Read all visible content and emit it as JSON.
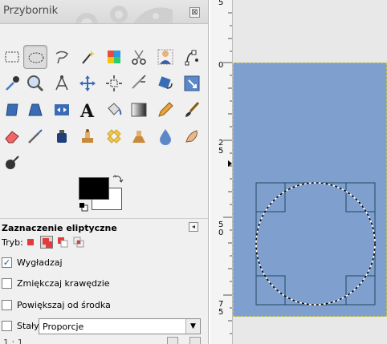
{
  "toolbox": {
    "title": "Przybornik",
    "close_symbol": "⊠",
    "tools": [
      {
        "name": "rect-select-icon"
      },
      {
        "name": "ellipse-select-icon",
        "active": true
      },
      {
        "name": "free-select-icon"
      },
      {
        "name": "fuzzy-select-icon"
      },
      {
        "name": "select-by-color-icon"
      },
      {
        "name": "scissors-icon"
      },
      {
        "name": "foreground-select-icon"
      },
      {
        "name": "paths-icon"
      },
      {
        "name": "color-picker-icon"
      },
      {
        "name": "zoom-icon"
      },
      {
        "name": "measure-icon"
      },
      {
        "name": "move-icon"
      },
      {
        "name": "align-icon"
      },
      {
        "name": "crop-icon"
      },
      {
        "name": "rotate-icon"
      },
      {
        "name": "scale-icon"
      },
      {
        "name": "shear-icon"
      },
      {
        "name": "perspective-icon"
      },
      {
        "name": "flip-icon"
      },
      {
        "name": "text-icon"
      },
      {
        "name": "bucket-fill-icon"
      },
      {
        "name": "blend-icon"
      },
      {
        "name": "pencil-icon"
      },
      {
        "name": "paintbrush-icon"
      },
      {
        "name": "eraser-icon"
      },
      {
        "name": "airbrush-icon"
      },
      {
        "name": "ink-icon"
      },
      {
        "name": "clone-icon"
      },
      {
        "name": "heal-icon"
      },
      {
        "name": "perspective-clone-icon"
      },
      {
        "name": "blur-icon"
      },
      {
        "name": "smudge-icon"
      },
      {
        "name": "dodge-burn-icon"
      }
    ],
    "colors": {
      "foreground": "#000000",
      "background": "#ffffff"
    }
  },
  "tool_options": {
    "title": "Zaznaczenie eliptyczne",
    "mode_label": "Tryb:",
    "antialias": {
      "label": "Wygładzaj",
      "checked": true
    },
    "feather": {
      "label": "Zmiękczaj krawędzie",
      "checked": false
    },
    "expand": {
      "label": "Powiększaj od środka",
      "checked": false
    },
    "fixed": {
      "label": "Stały:",
      "checked": false,
      "value": "Proporcje"
    },
    "cut_text": "1 : 1 ...",
    "menu_symbol": "◂",
    "dropdown_symbol": "▼"
  },
  "canvas": {
    "ruler_labels": [
      "5",
      "0",
      "2",
      "5",
      "5",
      "0",
      "7",
      "5"
    ],
    "image_color": "#7f9fcf"
  }
}
